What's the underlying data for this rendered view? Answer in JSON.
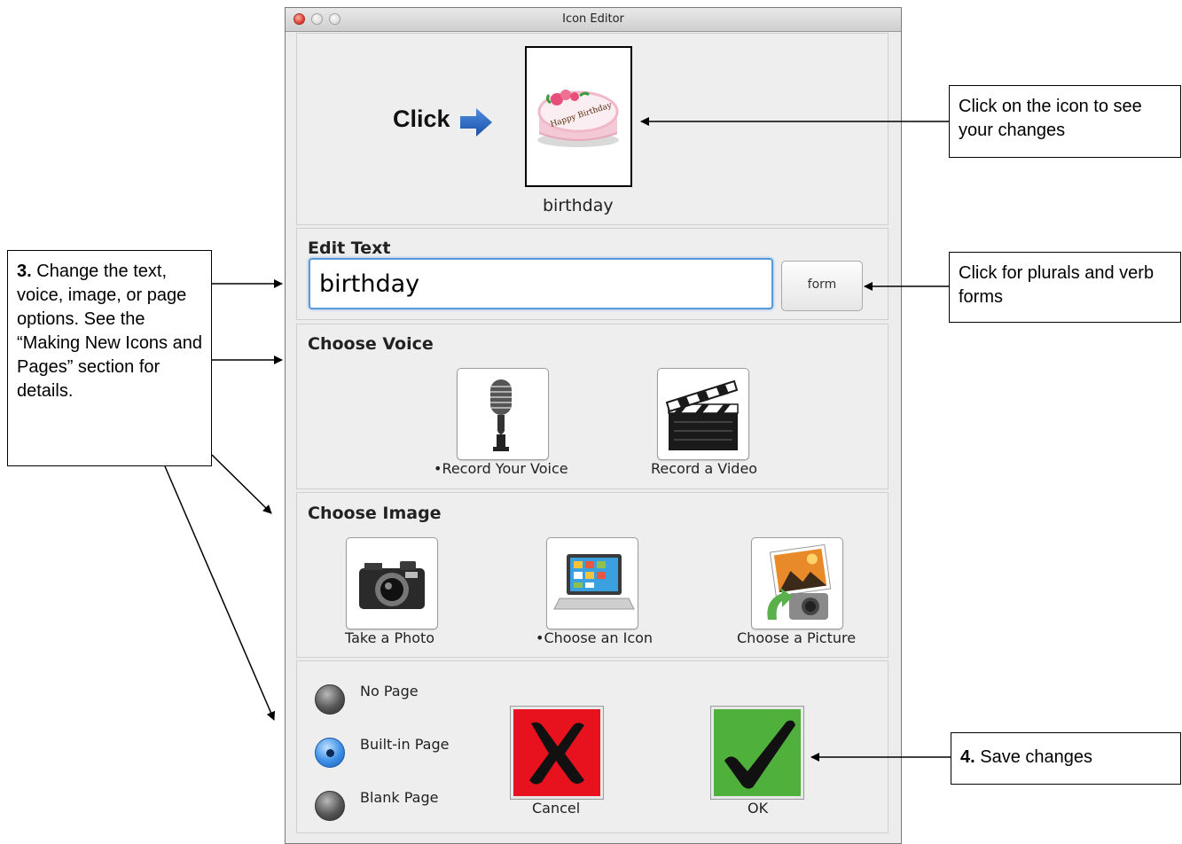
{
  "window": {
    "title": "Icon Editor"
  },
  "preview": {
    "click_label": "Click",
    "icon_label": "birthday",
    "cake_text": "Happy Birthday"
  },
  "edit_text": {
    "heading": "Edit Text",
    "value": "birthday",
    "form_label": "form"
  },
  "choose_voice": {
    "heading": "Choose Voice",
    "record_voice": "•Record Your Voice",
    "record_video": "Record a Video"
  },
  "choose_image": {
    "heading": "Choose Image",
    "take_photo": "Take a Photo",
    "choose_icon": "•Choose an Icon",
    "choose_picture": "Choose a Picture"
  },
  "page_options": {
    "no_page": "No Page",
    "built_in_page": "Built-in Page",
    "blank_page": "Blank Page",
    "selected": "Built-in Page"
  },
  "actions": {
    "cancel": "Cancel",
    "ok": "OK"
  },
  "callouts": {
    "click_icon": "Click on the icon to see your changes",
    "plurals": "Click for plurals and verb forms",
    "step3_num": "3.",
    "step3_text": "Change the text, voice, image, or page options. See the “Making New Icons and Pages” section for details.",
    "step4_num": "4.",
    "step4_text": "Save changes"
  },
  "colors": {
    "cancel_bg": "#e8121f",
    "ok_bg": "#4fb03b",
    "accent": "#2a6ecf",
    "focus": "#5b9ad8"
  }
}
